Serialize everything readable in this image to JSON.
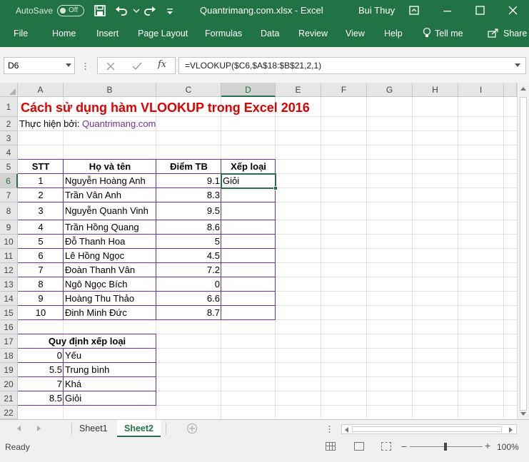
{
  "titlebar": {
    "autosave_label": "AutoSave",
    "autosave_state": "Off",
    "doc_title": "Quantrimang.com.xlsx  -  Excel",
    "user": "Bui Thuy"
  },
  "ribbon": {
    "tabs": [
      "File",
      "Home",
      "Insert",
      "Page Layout",
      "Formulas",
      "Data",
      "Review",
      "View",
      "Help",
      "Tell me",
      "Share"
    ]
  },
  "formula_bar": {
    "name_box": "D6",
    "formula": "=VLOOKUP($C6,$A$18:$B$21,2,1)"
  },
  "columns": [
    "A",
    "B",
    "C",
    "D",
    "E",
    "F",
    "G",
    "H",
    "I"
  ],
  "rows": [
    "1",
    "2",
    "3",
    "4",
    "5",
    "6",
    "7",
    "8",
    "9",
    "10",
    "11",
    "12",
    "13",
    "14",
    "15",
    "16",
    "17",
    "18",
    "19",
    "20",
    "21",
    "22"
  ],
  "sheet": {
    "title": "Cách sử dụng hàm VLOOKUP trong Excel 2016",
    "author_label": "Thực hiện bởi: ",
    "author_link": "Quantrimang.com",
    "headers": [
      "STT",
      "Họ và tên",
      "Điểm TB",
      "Xếp loại"
    ],
    "students": [
      {
        "stt": "1",
        "name": "Nguyễn Hoàng Anh",
        "score": "9.1",
        "grade": "Giỏi"
      },
      {
        "stt": "2",
        "name": "Trần Vân Anh",
        "score": "8.3",
        "grade": ""
      },
      {
        "stt": "3",
        "name": "Nguyễn Quanh Vinh",
        "score": "9.5",
        "grade": ""
      },
      {
        "stt": "4",
        "name": "Trần Hồng Quang",
        "score": "8.6",
        "grade": ""
      },
      {
        "stt": "5",
        "name": "Đỗ Thanh Hoa",
        "score": "5",
        "grade": ""
      },
      {
        "stt": "6",
        "name": "Lê Hồng Ngọc",
        "score": "4.5",
        "grade": ""
      },
      {
        "stt": "7",
        "name": "Đoàn Thanh Vân",
        "score": "7.2",
        "grade": ""
      },
      {
        "stt": "8",
        "name": "Ngô Ngọc Bích",
        "score": "0",
        "grade": ""
      },
      {
        "stt": "9",
        "name": "Hoàng Thu Thảo",
        "score": "6.6",
        "grade": ""
      },
      {
        "stt": "10",
        "name": "Đinh Minh Đức",
        "score": "8.7",
        "grade": ""
      }
    ],
    "rules_title": "Quy định xếp loại",
    "rules": [
      {
        "min": "0",
        "label": "Yếu"
      },
      {
        "min": "5.5",
        "label": "Trung bình"
      },
      {
        "min": "7",
        "label": "Khá"
      },
      {
        "min": "8.5",
        "label": "Giỏi"
      }
    ]
  },
  "sheet_tabs": [
    "Sheet1",
    "Sheet2"
  ],
  "active_sheet": "Sheet2",
  "status": {
    "ready": "Ready",
    "zoom": "100%"
  },
  "colors": {
    "excel_green": "#217346",
    "title_red": "#e00000",
    "link_purple": "#7030a0",
    "border_purple": "#7030a0"
  }
}
